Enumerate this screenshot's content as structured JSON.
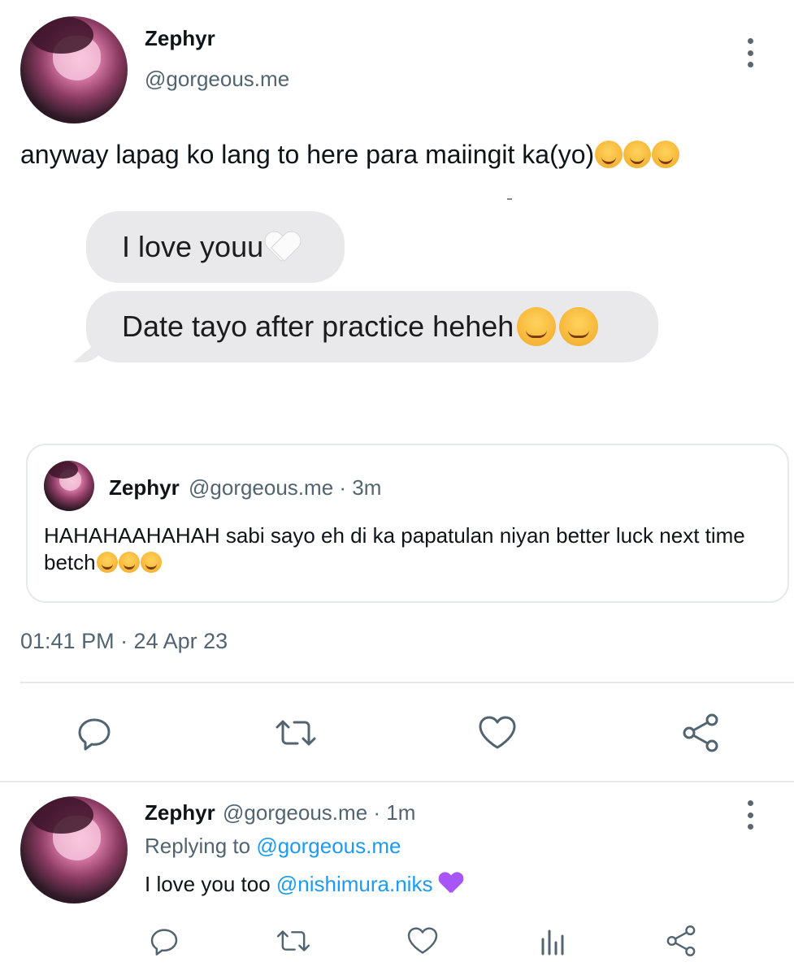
{
  "tweet": {
    "author_name": "Zephyr",
    "author_handle": "@gorgeous.me",
    "text": "anyway lapag ko lang to here para maiingit ka(yo)",
    "text_emojis": "🥰🥰🥰",
    "image_messages": [
      {
        "text": "I love youu",
        "emoji": "🤍"
      },
      {
        "text": "Date tayo after practice heheh",
        "emoji": "😘🥰"
      }
    ],
    "timestamp": "01:41 PM · 24 Apr 23",
    "more_icon": "kebab-icon"
  },
  "quoted_tweet": {
    "author_name": "Zephyr",
    "author_handle": "@gorgeous.me · 3m",
    "text": "HAHAHAAHAHAH sabi sayo eh di ka papatulan niyan better luck next time betch",
    "emojis": "🤪🤪🤪"
  },
  "actions": [
    {
      "icon": "reply-icon"
    },
    {
      "icon": "retweet-icon"
    },
    {
      "icon": "like-icon"
    },
    {
      "icon": "share-icon"
    }
  ],
  "reply": {
    "author_name": "Zephyr",
    "author_handle": "@gorgeous.me · 1m",
    "replying_prefix": "Replying to ",
    "replying_handle": "@gorgeous.me",
    "text_prefix": "I love you too ",
    "mention": "@nishimura.niks",
    "emoji": "💜",
    "actions": [
      {
        "icon": "reply-icon"
      },
      {
        "icon": "retweet-icon"
      },
      {
        "icon": "like-icon"
      },
      {
        "icon": "analytics-icon"
      },
      {
        "icon": "share-icon"
      }
    ]
  },
  "colors": {
    "link": "#1d9bf0",
    "secondary_text": "#536471",
    "bubble": "#e9e9eb",
    "heart_purple": "#a855f7"
  }
}
